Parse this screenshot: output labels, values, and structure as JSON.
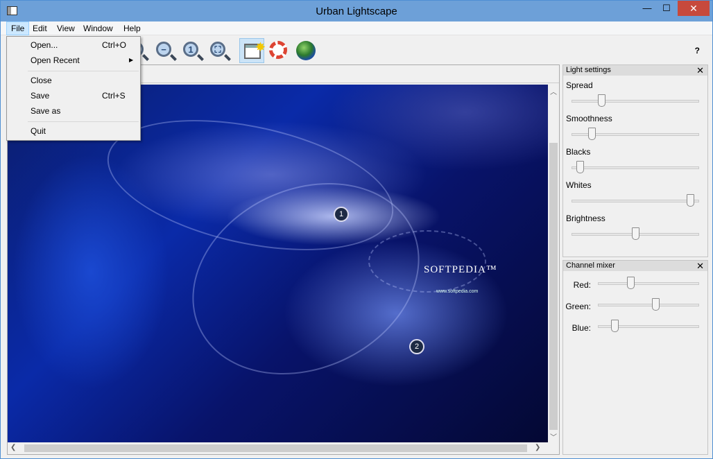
{
  "window": {
    "title": "Urban Lightscape",
    "controls": {
      "minimize": "—",
      "maximize": "☐",
      "close": "✕"
    }
  },
  "menu": {
    "items": [
      "File",
      "Edit",
      "View",
      "Window",
      "Help"
    ]
  },
  "file_menu": {
    "items": [
      {
        "label": "Open...",
        "shortcut": "Ctrl+O"
      },
      {
        "label": "Open Recent",
        "submenu_arrow": "▶"
      },
      {
        "label": "Close"
      },
      {
        "label": "Save",
        "shortcut": "Ctrl+S"
      },
      {
        "label": "Save as"
      },
      {
        "label": "Quit"
      }
    ]
  },
  "toolbar": {
    "icons": [
      "zoom-in-icon",
      "zoom-out-icon",
      "zoom-actual-icon",
      "zoom-fit-icon",
      "new-window-icon",
      "help-lifebuoy-icon",
      "web-globe-icon"
    ],
    "zoom_actual_glyph": "1",
    "help_label": "?"
  },
  "image": {
    "watermark_brand": "SOFTPEDIA™",
    "watermark_url": "www.softpedia.com",
    "markers": [
      "1",
      "2"
    ]
  },
  "light_settings": {
    "title": "Light settings",
    "close": "✕",
    "sliders": [
      {
        "label": "Spread",
        "value": 0.22
      },
      {
        "label": "Smoothness",
        "value": 0.14
      },
      {
        "label": "Blacks",
        "value": 0.04
      },
      {
        "label": "Whites",
        "value": 0.96
      },
      {
        "label": "Brightness",
        "value": 0.5
      }
    ]
  },
  "channel_mixer": {
    "title": "Channel mixer",
    "close": "✕",
    "sliders": [
      {
        "label": "Red:",
        "value": 0.31
      },
      {
        "label": "Green:",
        "value": 0.58
      },
      {
        "label": "Blue:",
        "value": 0.14
      }
    ]
  },
  "scroll": {
    "up": "︿",
    "down": "﹀",
    "left": "❮",
    "right": "❯"
  }
}
